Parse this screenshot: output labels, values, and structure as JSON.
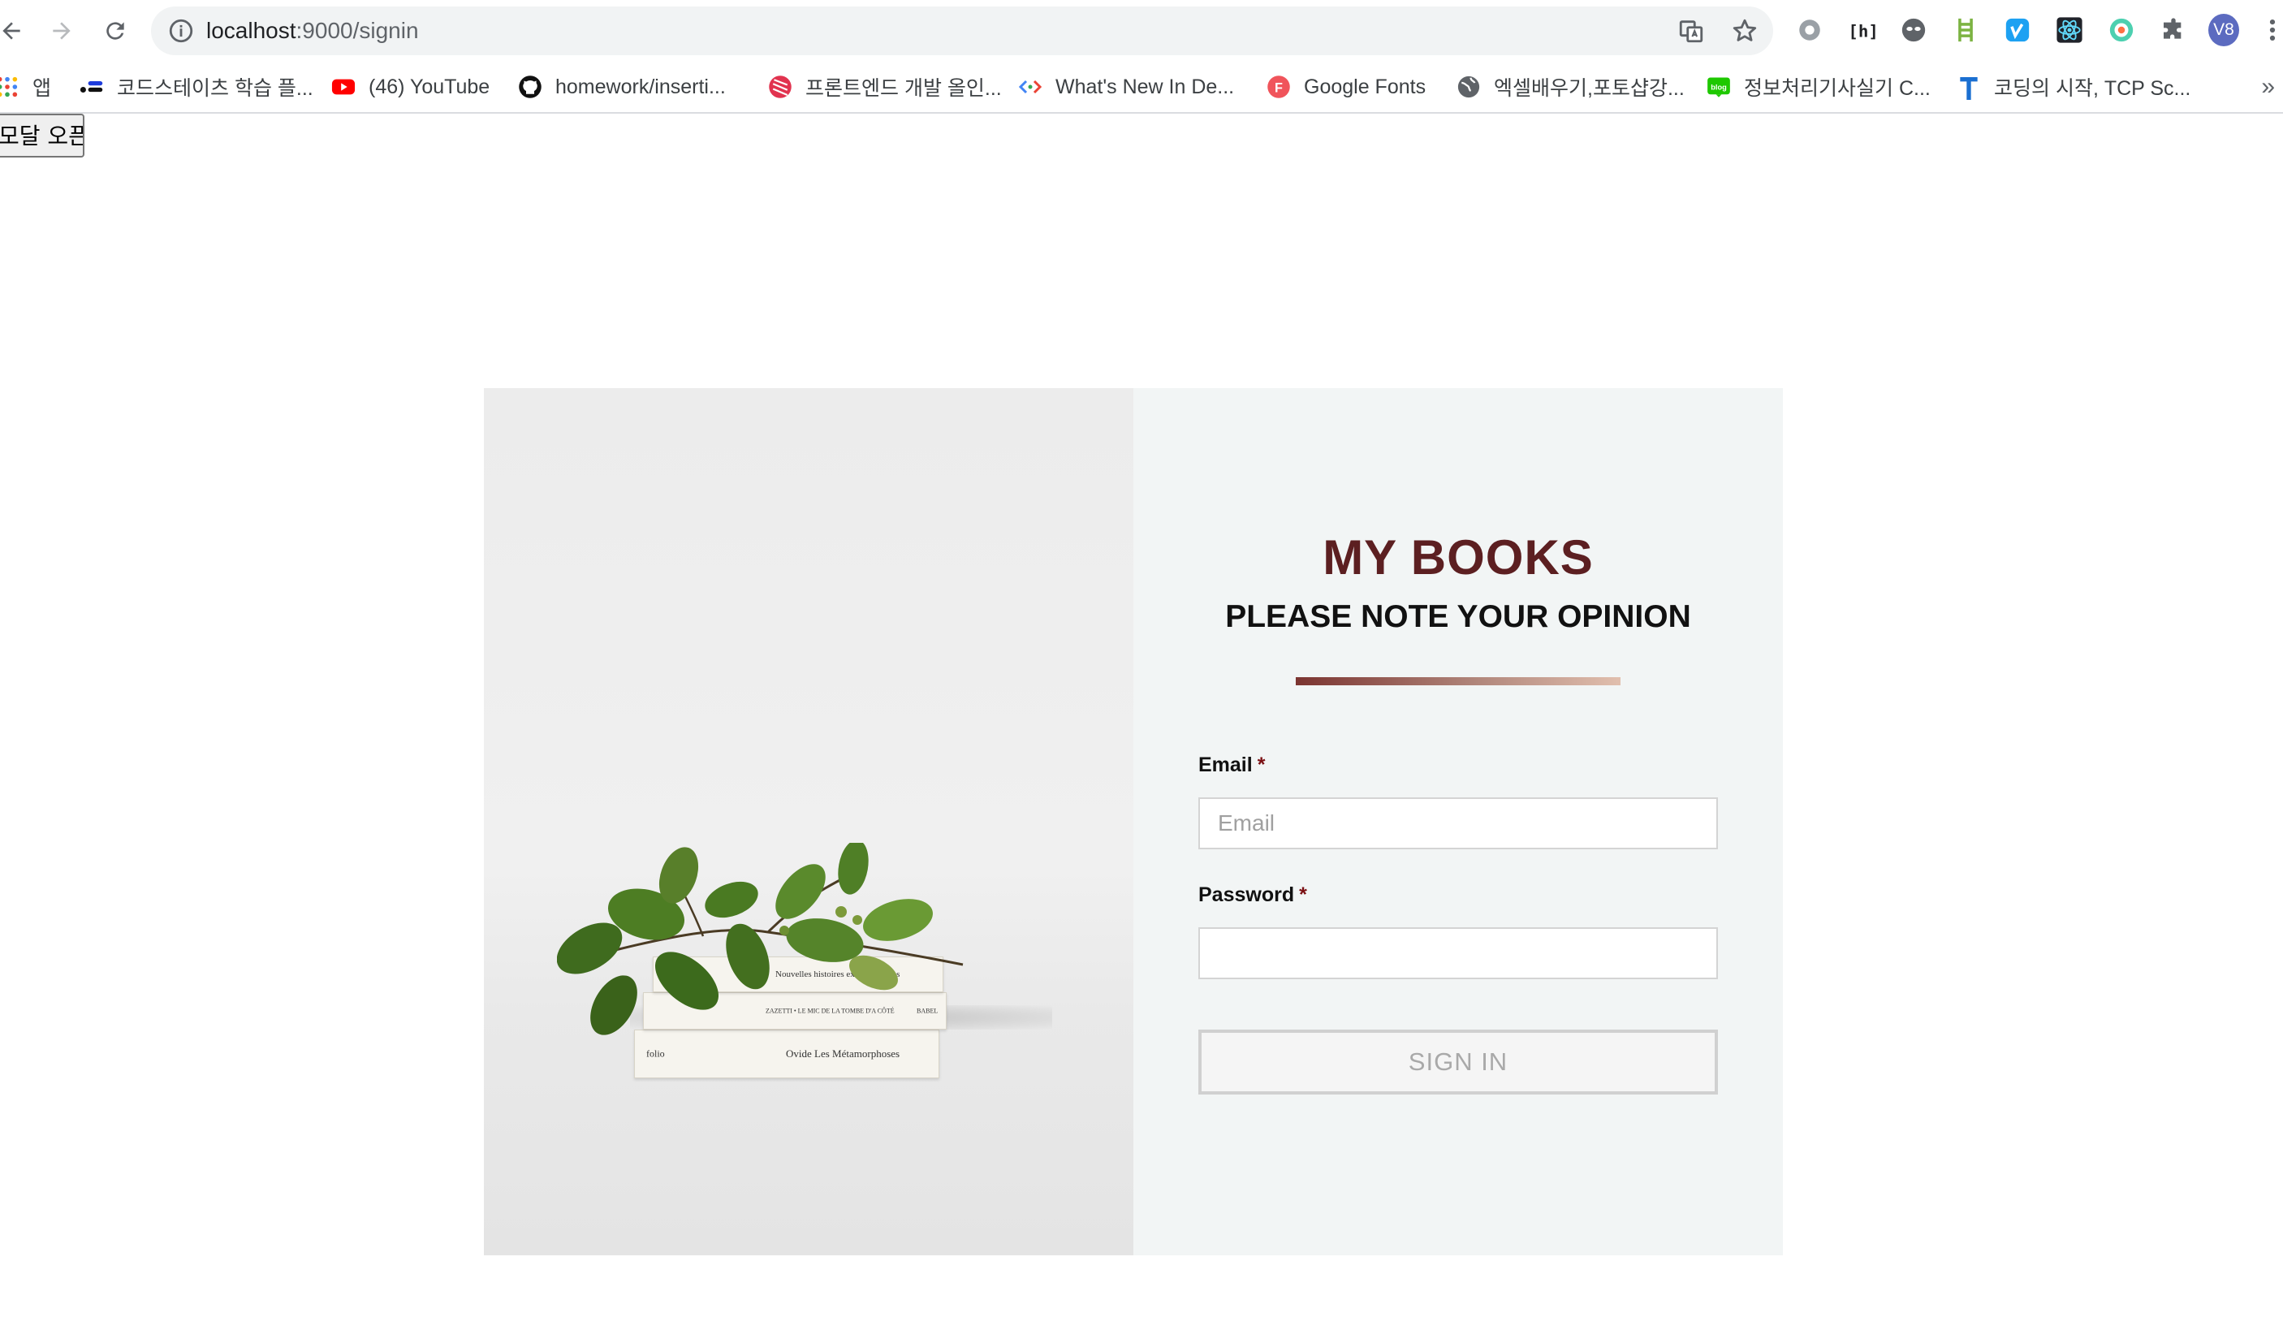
{
  "browser": {
    "url_host": "localhost",
    "url_path": ":9000/signin",
    "profile_initials": "V8",
    "bookmarks": [
      {
        "label": "앱",
        "icon": "apps-grid-icon"
      },
      {
        "label": "코드스테이츠 학습 플...",
        "icon": "codestates-icon"
      },
      {
        "label": "(46) YouTube",
        "icon": "youtube-icon"
      },
      {
        "label": "homework/inserti...",
        "icon": "github-icon"
      },
      {
        "label": "프론트엔드 개발 올인...",
        "icon": "bookmark-site-icon"
      },
      {
        "label": "What's New In De...",
        "icon": "devtools-icon"
      },
      {
        "label": "Google Fonts",
        "icon": "google-fonts-icon"
      },
      {
        "label": "엑셀배우기,포토샵강...",
        "icon": "globe-icon"
      },
      {
        "label": "정보처리기사실기 C...",
        "icon": "blog-icon"
      },
      {
        "label": "코딩의 시작, TCP Sc...",
        "icon": "tcp-school-icon"
      }
    ],
    "bookmarks_more": "»"
  },
  "page": {
    "modal_button": "모달 오픈",
    "title": "MY BOOKS",
    "subtitle": "PLEASE NOTE YOUR OPINION",
    "email_label": "Email",
    "email_placeholder": "Email",
    "password_label": "Password",
    "required_mark": "*",
    "signin_button": "SIGN IN"
  },
  "image": {
    "book_titles": [
      "Nouvelles histoires extraordinaires",
      "ZAZETTI • LE MIC DE LA TOMBE D'A CÔTÉ",
      "Ovide  Les Métamorphoses"
    ],
    "book_publishers": [
      "folio",
      "BABEL"
    ]
  },
  "colors": {
    "title": "#5c1f21",
    "form_background": "#f2f5f5",
    "required": "#7a0f12",
    "divider_start": "#7b3430",
    "divider_end": "#e1bfae"
  }
}
